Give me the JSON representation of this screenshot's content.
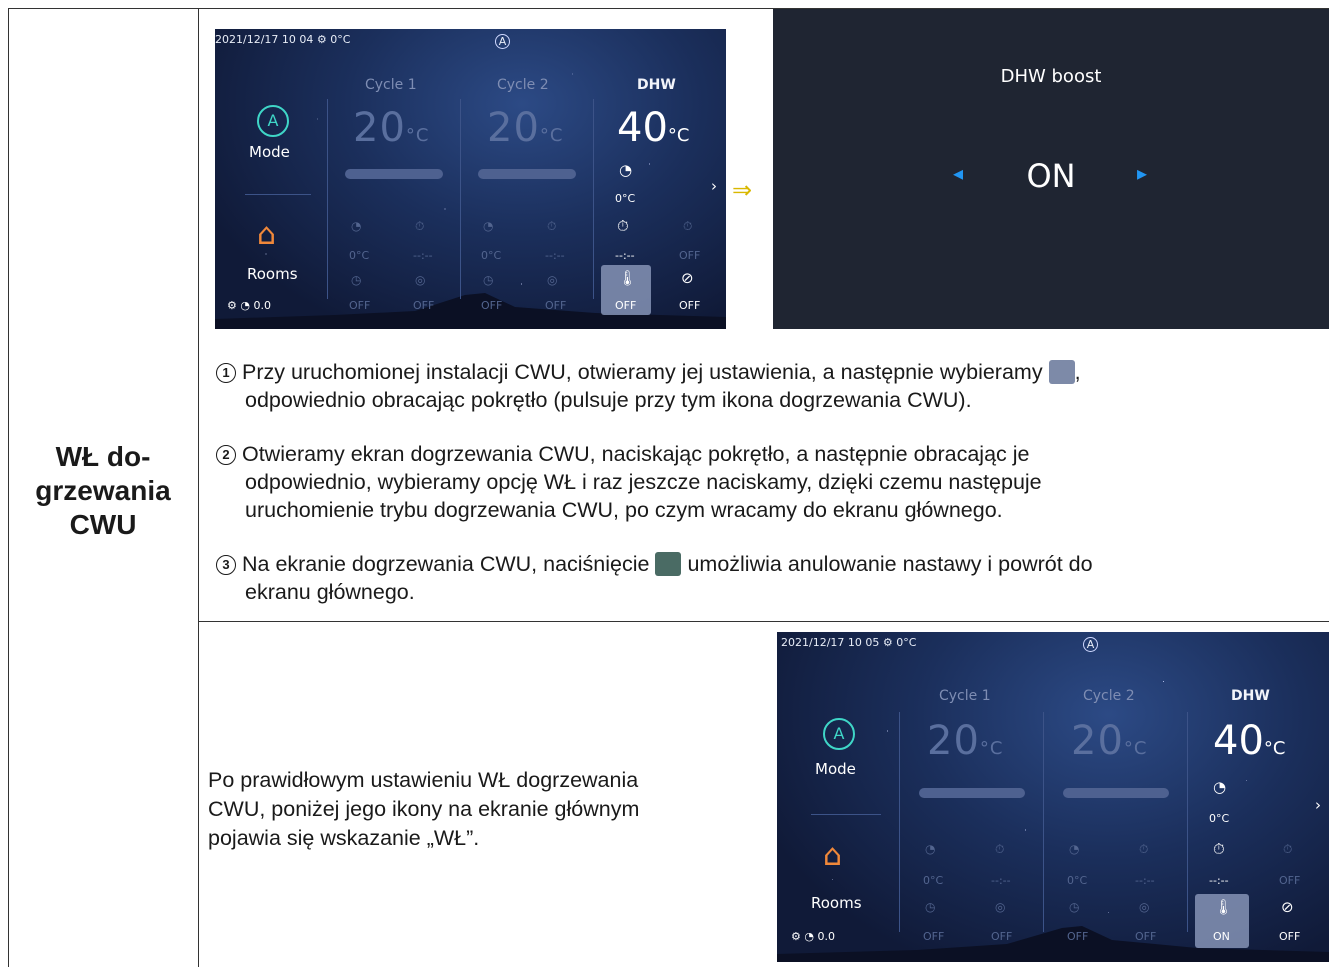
{
  "row_label": [
    "WŁ do-",
    "grzewania",
    "CWU"
  ],
  "screen1": {
    "datetime": "2021/12/17 10 04",
    "outdoor_temp": "0°C",
    "auto_badge": "A",
    "cycle1_label": "Cycle 1",
    "cycle2_label": "Cycle 2",
    "dhw_label": "DHW",
    "cycle1_temp": "20",
    "cycle2_temp": "20",
    "dhw_temp": "40",
    "unit": "°C",
    "mode_label": "Mode",
    "rooms_label": "Rooms",
    "dhw_sub_temp": "0°C",
    "dhw_timer": "--:--",
    "boost_state": "OFF",
    "eco_state": "OFF",
    "pressure": "0.0",
    "cyc_small_temp": "0°C",
    "cyc_small_timer": "--:--",
    "cyc_small_off": "OFF"
  },
  "boost_screen": {
    "title": "DHW boost",
    "value": "ON",
    "arrow_left": "◂",
    "arrow_right": "▸"
  },
  "arrow_glyph": "⇒",
  "steps": [
    {
      "num": "1",
      "text_a": "Przy uruchomionej instalacji CWU, otwieramy jej ustawienia, a następnie wybieramy",
      "text_b": ",",
      "text_c": "odpowiednio obracając pokrętło (pulsuje przy tym ikona dogrzewania CWU)."
    },
    {
      "num": "2",
      "line1": "Otwieramy ekran dogrzewania CWU, naciskając pokrętło, a następnie obracając je",
      "line2": "odpowiednio, wybieramy opcję WŁ i raz jeszcze naciskamy, dzięki czemu następuje",
      "line3": "uruchomienie trybu dogrzewania CWU, po czym wracamy do ekranu głównego."
    },
    {
      "num": "3",
      "text_a": "Na ekranie dogrzewania CWU, naciśnięcie",
      "text_b": "umożliwia anulowanie nastawy i powrót do",
      "text_c": "ekranu głównego."
    }
  ],
  "bottom_text": [
    "Po prawidłowym ustawieniu WŁ dogrzewania",
    "CWU, poniżej jego ikony na ekranie głównym",
    "pojawia się wskazanie „WŁ”."
  ],
  "screen2": {
    "datetime": "2021/12/17 10 05",
    "outdoor_temp": "0°C",
    "auto_badge": "A",
    "cycle1_label": "Cycle 1",
    "cycle2_label": "Cycle 2",
    "dhw_label": "DHW",
    "cycle1_temp": "20",
    "cycle2_temp": "20",
    "dhw_temp": "40",
    "unit": "°C",
    "mode_label": "Mode",
    "rooms_label": "Rooms",
    "dhw_sub_temp": "0°C",
    "dhw_timer": "--:--",
    "boost_state": "ON",
    "eco_state": "OFF",
    "pressure": "0.0",
    "cyc_small_temp": "0°C",
    "cyc_small_timer": "--:--",
    "cyc_small_off": "OFF"
  },
  "icons": [
    "gauge-icon",
    "timer-icon",
    "boost-thermometer-icon",
    "eco-off-icon",
    "home-icon",
    "mode-auto-icon",
    "chevron-right-icon",
    "back-icon"
  ],
  "colors": {
    "mode_accent": "#3fd6c7",
    "home_accent": "#f0883a",
    "boost_bg": "#1f2532",
    "boost_arrow": "#2196f3",
    "arrow_yellow": "#f2d21b"
  }
}
